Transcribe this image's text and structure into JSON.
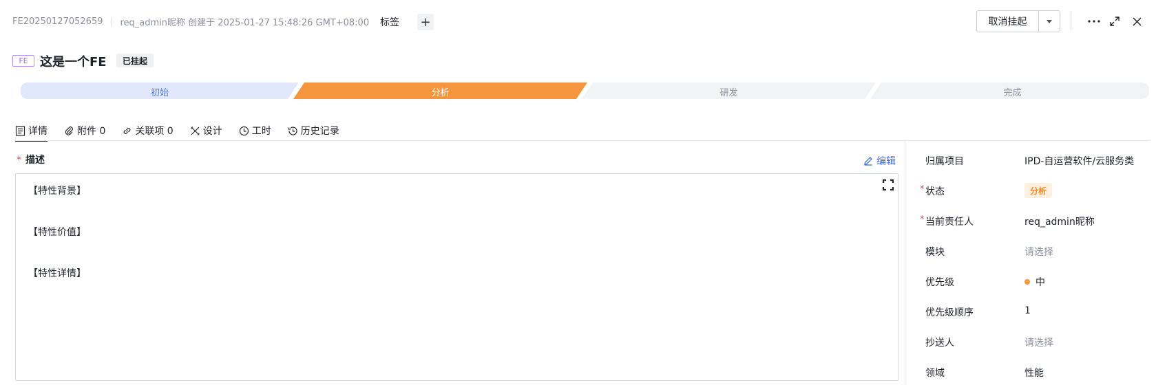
{
  "header": {
    "item_id": "FE20250127052659",
    "created_info": "req_admin昵称 创建于 2025-01-27 15:48:26 GMT+08:00",
    "tags_label": "标签",
    "add_tag_symbol": "+",
    "unsuspend_label": "取消挂起"
  },
  "title": {
    "type_badge": "FE",
    "text": "这是一个FE",
    "status": "已挂起"
  },
  "stages": [
    {
      "label": "初始",
      "state": "done",
      "color": "#e1e8fb",
      "text_color": "#5b7fd1"
    },
    {
      "label": "分析",
      "state": "current",
      "color": "#f5963e",
      "text_color": "#ffffff"
    },
    {
      "label": "研发",
      "state": "todo",
      "color": "#f2f3f5",
      "text_color": "#8a8f99"
    },
    {
      "label": "完成",
      "state": "todo",
      "color": "#f2f3f5",
      "text_color": "#8a8f99"
    }
  ],
  "tabs": [
    {
      "label": "详情",
      "icon": "document-icon"
    },
    {
      "label": "附件 0",
      "icon": "paperclip-icon"
    },
    {
      "label": "关联项 0",
      "icon": "link-icon"
    },
    {
      "label": "设计",
      "icon": "design-tools-icon"
    },
    {
      "label": "工时",
      "icon": "clock-icon"
    },
    {
      "label": "历史记录",
      "icon": "history-icon"
    }
  ],
  "description": {
    "required_mark": "*",
    "title": "描述",
    "edit_label": "编辑",
    "lines": [
      "【特性背景】",
      "【特性价值】",
      "【特性详情】"
    ]
  },
  "properties": [
    {
      "label": "归属项目",
      "value": "IPD-自运营软件/云服务类",
      "required": false
    },
    {
      "label": "状态",
      "value": "分析",
      "required": true
    },
    {
      "label": "当前责任人",
      "value": "req_admin昵称",
      "required": true
    },
    {
      "label": "模块",
      "value": "请选择",
      "required": false
    },
    {
      "label": "优先级",
      "value": "中",
      "required": false
    },
    {
      "label": "优先级顺序",
      "value": "1",
      "required": false
    },
    {
      "label": "抄送人",
      "value": "请选择",
      "required": false
    },
    {
      "label": "领域",
      "value": "性能",
      "required": false
    }
  ],
  "colors": {
    "accent": "#3d6bd6",
    "stage_current": "#f5963e",
    "required": "#e34d59",
    "priority_medium": "#f2993a"
  }
}
